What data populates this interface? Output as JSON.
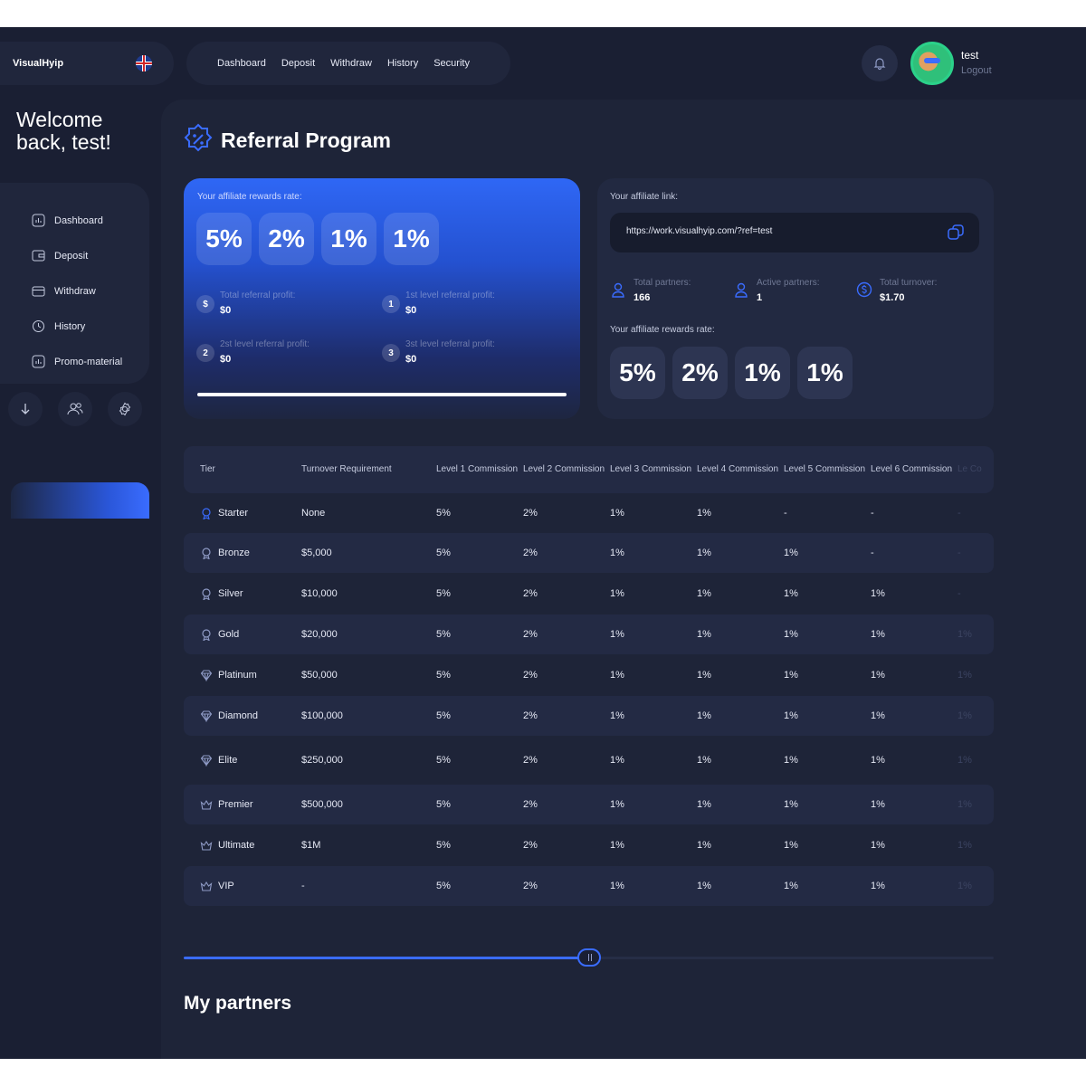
{
  "brand": "VisualHyip",
  "topnav": [
    "Dashboard",
    "Deposit",
    "Withdraw",
    "History",
    "Security"
  ],
  "user": {
    "name": "test",
    "logout": "Logout"
  },
  "welcome": "Welcome back, test!",
  "sidebar": {
    "items": [
      {
        "label": "Dashboard",
        "icon": "chart-icon"
      },
      {
        "label": "Deposit",
        "icon": "wallet-icon"
      },
      {
        "label": "Withdraw",
        "icon": "card-icon"
      },
      {
        "label": "History",
        "icon": "clock-icon"
      },
      {
        "label": "Promo-material",
        "icon": "chart-icon"
      }
    ]
  },
  "page_title": "Referral Program",
  "rewards": {
    "label": "Your affiliate rewards rate:",
    "rates": [
      "5%",
      "2%",
      "1%",
      "1%"
    ],
    "stats": [
      {
        "badge": "$",
        "title": "Total referral profit:",
        "value": "$0"
      },
      {
        "badge": "1",
        "title": "1st level referral profit:",
        "value": "$0"
      },
      {
        "badge": "2",
        "title": "2st level referral profit:",
        "value": "$0"
      },
      {
        "badge": "3",
        "title": "3st level referral profit:",
        "value": "$0"
      }
    ]
  },
  "affiliate": {
    "label": "Your affiliate link:",
    "url": "https://work.visualhyip.com/?ref=test",
    "stats": [
      {
        "title": "Total partners:",
        "value": "166"
      },
      {
        "title": "Active partners:",
        "value": "1"
      },
      {
        "title": "Total turnover:",
        "value": "$1.70"
      }
    ],
    "rates_label": "Your affiliate rewards rate:",
    "rates": [
      "5%",
      "2%",
      "1%",
      "1%"
    ]
  },
  "table": {
    "headers": [
      "Tier",
      "Turnover Requirement",
      "Level 1 Commission",
      "Level 2 Commission",
      "Level 3 Commission",
      "Level 4 Commission",
      "Level 5 Commission",
      "Level 6 Commission",
      "Le Co"
    ],
    "rows": [
      {
        "tier": "Starter",
        "req": "None",
        "l1": "5%",
        "l2": "2%",
        "l3": "1%",
        "l4": "1%",
        "l5": "-",
        "l6": "-",
        "l7": "-"
      },
      {
        "tier": "Bronze",
        "req": "$5,000",
        "l1": "5%",
        "l2": "2%",
        "l3": "1%",
        "l4": "1%",
        "l5": "1%",
        "l6": "-",
        "l7": "-"
      },
      {
        "tier": "Silver",
        "req": "$10,000",
        "l1": "5%",
        "l2": "2%",
        "l3": "1%",
        "l4": "1%",
        "l5": "1%",
        "l6": "1%",
        "l7": "-"
      },
      {
        "tier": "Gold",
        "req": "$20,000",
        "l1": "5%",
        "l2": "2%",
        "l3": "1%",
        "l4": "1%",
        "l5": "1%",
        "l6": "1%",
        "l7": "1%"
      },
      {
        "tier": "Platinum",
        "req": "$50,000",
        "l1": "5%",
        "l2": "2%",
        "l3": "1%",
        "l4": "1%",
        "l5": "1%",
        "l6": "1%",
        "l7": "1%"
      },
      {
        "tier": "Diamond",
        "req": "$100,000",
        "l1": "5%",
        "l2": "2%",
        "l3": "1%",
        "l4": "1%",
        "l5": "1%",
        "l6": "1%",
        "l7": "1%"
      },
      {
        "tier": "Elite",
        "req": "$250,000",
        "l1": "5%",
        "l2": "2%",
        "l3": "1%",
        "l4": "1%",
        "l5": "1%",
        "l6": "1%",
        "l7": "1%"
      },
      {
        "tier": "Premier",
        "req": "$500,000",
        "l1": "5%",
        "l2": "2%",
        "l3": "1%",
        "l4": "1%",
        "l5": "1%",
        "l6": "1%",
        "l7": "1%"
      },
      {
        "tier": "Ultimate",
        "req": "$1M",
        "l1": "5%",
        "l2": "2%",
        "l3": "1%",
        "l4": "1%",
        "l5": "1%",
        "l6": "1%",
        "l7": "1%"
      },
      {
        "tier": "VIP",
        "req": "-",
        "l1": "5%",
        "l2": "2%",
        "l3": "1%",
        "l4": "1%",
        "l5": "1%",
        "l6": "1%",
        "l7": "1%"
      }
    ]
  },
  "table_scroll_fraction": 0.5,
  "partners_title": "My partners",
  "colors": {
    "background": "#1a1f33",
    "panel": "#20263c",
    "accent": "#3a6cff"
  }
}
